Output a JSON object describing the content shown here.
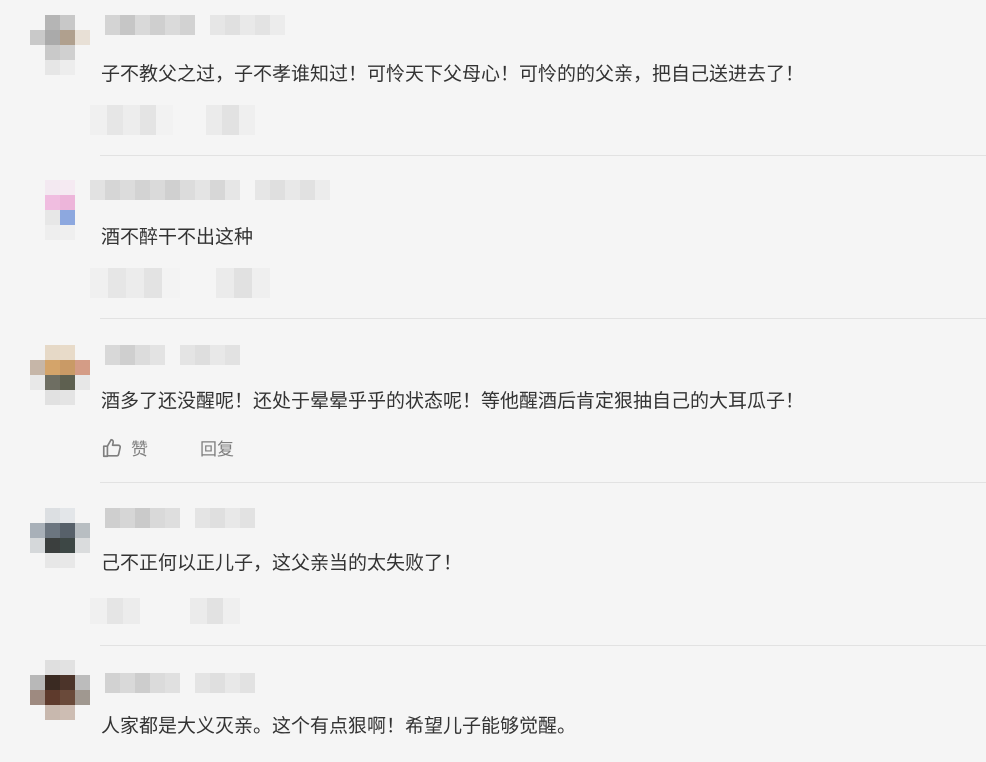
{
  "comments": [
    {
      "text": "子不教父之过，子不孝谁知过！可怜天下父母心！可怜的的父亲，把自己送进去了！",
      "actions_visible": false,
      "avatar_colors": [
        "#f5f5f5",
        "#b5b5b5",
        "#c8c8c8",
        "#f5f5f5",
        "#c9c9c9",
        "#aaaaaa",
        "#b0a08e",
        "#e8e0d6",
        "#f5f5f5",
        "#c9c9c9",
        "#d0d0d0",
        "#f5f5f5",
        "#f5f5f5",
        "#e6e6e6",
        "#ededed",
        "#f5f5f5"
      ]
    },
    {
      "text": "酒不醉干不出这种",
      "actions_visible": false,
      "avatar_colors": [
        "#f5f5f5",
        "#f3e9f1",
        "#f5eaf2",
        "#f5f5f5",
        "#f5f5f5",
        "#f0bde0",
        "#edb5da",
        "#f5f5f5",
        "#f5f5f5",
        "#e7e7e7",
        "#8da8df",
        "#f5f5f5",
        "#f5f5f5",
        "#eeeeee",
        "#efefef",
        "#f5f5f5"
      ]
    },
    {
      "text": "酒多了还没醒呢！还处于晕晕乎乎的状态呢！等他醒酒后肯定狠抽自己的大耳瓜子！",
      "actions_visible": true,
      "like_label": "赞",
      "reply_label": "回复",
      "avatar_colors": [
        "#f5f5f5",
        "#e6d9c7",
        "#e8dbc9",
        "#f5f5f5",
        "#c6b6a8",
        "#d4a46a",
        "#c99a66",
        "#d49c86",
        "#e8e8e8",
        "#6e6e62",
        "#5e6050",
        "#e7e7e7",
        "#f5f5f5",
        "#e1e1e1",
        "#e4e4e4",
        "#f5f5f5"
      ]
    },
    {
      "text": "己不正何以正儿子，这父亲当的太失败了！",
      "actions_visible": false,
      "avatar_colors": [
        "#f5f5f5",
        "#dcdfe2",
        "#e3e6e9",
        "#f5f5f5",
        "#a8b0b8",
        "#6c7680",
        "#57616a",
        "#b8bec2",
        "#d5d8da",
        "#3b3f3e",
        "#3d4745",
        "#dadcdd",
        "#f5f5f5",
        "#e7e7e7",
        "#e8e8e8",
        "#f5f5f5"
      ]
    },
    {
      "text": "人家都是大义灭亲。这个有点狠啊！希望儿子能够觉醒。",
      "actions_visible": false,
      "avatar_colors": [
        "#f5f5f5",
        "#dfdfdf",
        "#e2e2e2",
        "#f5f5f5",
        "#b8b8b8",
        "#3a2a22",
        "#4c342a",
        "#bcbcbc",
        "#9e8a80",
        "#5e3a2c",
        "#6a4a3a",
        "#a09890",
        "#f5f5f5",
        "#c8b8ae",
        "#cdbdb3",
        "#f5f5f5"
      ]
    }
  ]
}
